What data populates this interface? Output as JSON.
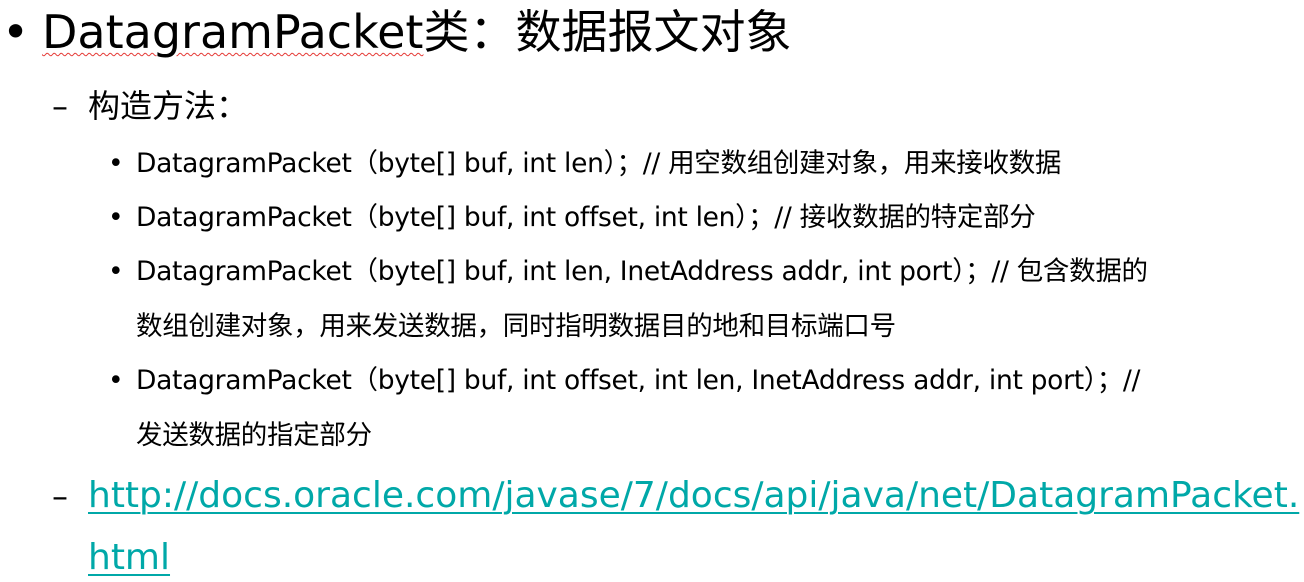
{
  "title": {
    "bullet": "•",
    "text_en": "DatagramPacket",
    "text_zh": "类：数据报文对象"
  },
  "constructors_heading": {
    "dash": "–",
    "text": "构造方法："
  },
  "constructors": [
    {
      "bullet": "•",
      "line1": "DatagramPacket（byte[]  buf, int len）；// 用空数组创建对象，用来接收数据",
      "line2": ""
    },
    {
      "bullet": "•",
      "line1": "DatagramPacket（byte[] buf, int offset, int len）；// 接收数据的特定部分",
      "line2": ""
    },
    {
      "bullet": "•",
      "line1": "DatagramPacket（byte[] buf, int len, InetAddress addr, int port）；// 包含数据的",
      "line2": "数组创建对象，用来发送数据，同时指明数据目的地和目标端口号"
    },
    {
      "bullet": "•",
      "line1": "DatagramPacket（byte[] buf, int offset, int len, InetAddress addr, int port）；//",
      "line2": "发送数据的指定部分"
    }
  ],
  "doc_link": {
    "dash": "–",
    "line1": "http://docs.oracle.com/javase/7/docs/api/java/net/DatagramPacket.",
    "line2": "html"
  }
}
